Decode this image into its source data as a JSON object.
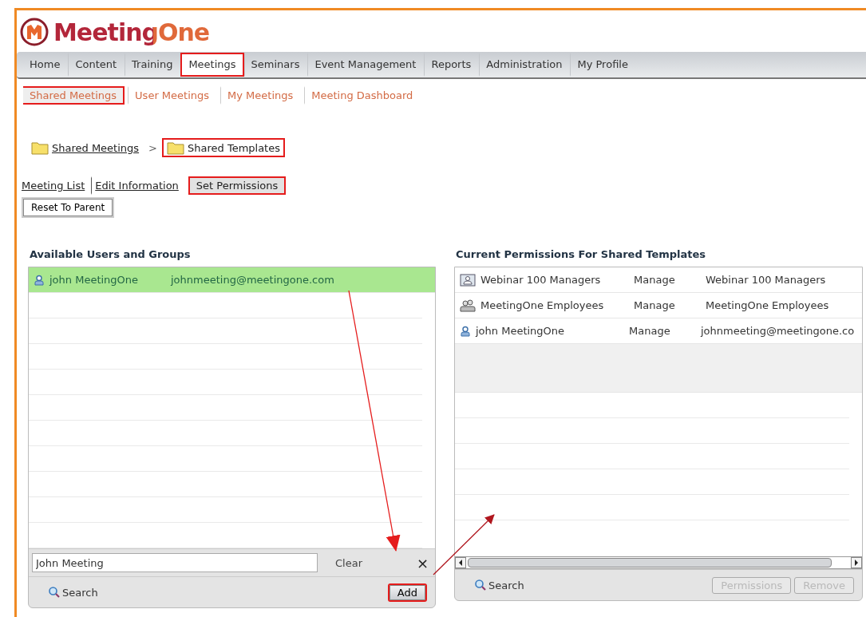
{
  "logo": {
    "text": "MeetingOne"
  },
  "nav": [
    {
      "label": "Home",
      "selected": false,
      "annotated": false
    },
    {
      "label": "Content",
      "selected": false,
      "annotated": false
    },
    {
      "label": "Training",
      "selected": false,
      "annotated": false
    },
    {
      "label": "Meetings",
      "selected": true,
      "annotated": true
    },
    {
      "label": "Seminars",
      "selected": false,
      "annotated": false
    },
    {
      "label": "Event Management",
      "selected": false,
      "annotated": false
    },
    {
      "label": "Reports",
      "selected": false,
      "annotated": false
    },
    {
      "label": "Administration",
      "selected": false,
      "annotated": false
    },
    {
      "label": "My Profile",
      "selected": false,
      "annotated": false
    }
  ],
  "subnav": [
    {
      "label": "Shared Meetings",
      "selected": true,
      "annotated": true
    },
    {
      "label": "User Meetings",
      "selected": false,
      "annotated": false
    },
    {
      "label": "My Meetings",
      "selected": false,
      "annotated": false
    },
    {
      "label": "Meeting Dashboard",
      "selected": false,
      "annotated": false
    }
  ],
  "breadcrumb": [
    {
      "label": "Shared Meetings",
      "current": false,
      "annotated": false
    },
    {
      "label": "Shared Templates",
      "current": true,
      "annotated": true
    }
  ],
  "breadcrumb_separator": ">",
  "tabs": [
    {
      "label": "Meeting List",
      "selected": false,
      "annotated": false
    },
    {
      "label": "Edit Information",
      "selected": false,
      "annotated": false
    },
    {
      "label": "Set Permissions",
      "selected": true,
      "annotated": true
    }
  ],
  "reset_button": "Reset To Parent",
  "available": {
    "title": "Available Users and Groups",
    "rows": [
      {
        "kind": "user",
        "name": "john MeetingOne",
        "email": "johnmeeting@meetingone.com",
        "selected": true
      }
    ],
    "search_value": "John Meeting",
    "clear": "Clear",
    "close": "×",
    "search": "Search",
    "add": {
      "label": "Add",
      "annotated": true
    }
  },
  "current": {
    "title": "Current Permissions For Shared Templates",
    "rows": [
      {
        "kind": "team",
        "name": "Webinar 100 Managers",
        "permission": "Manage",
        "description": "Webinar 100 Managers",
        "selected": false
      },
      {
        "kind": "group",
        "name": "MeetingOne Employees",
        "permission": "Manage",
        "description": "MeetingOne Employees",
        "selected": false
      },
      {
        "kind": "user",
        "name": "john MeetingOne",
        "permission": "Manage",
        "description": "johnmeeting@meetingone.co",
        "selected": false
      }
    ],
    "search": "Search",
    "buttons": [
      {
        "label": "Permissions",
        "disabled": true
      },
      {
        "label": "Remove",
        "disabled": true
      }
    ]
  }
}
